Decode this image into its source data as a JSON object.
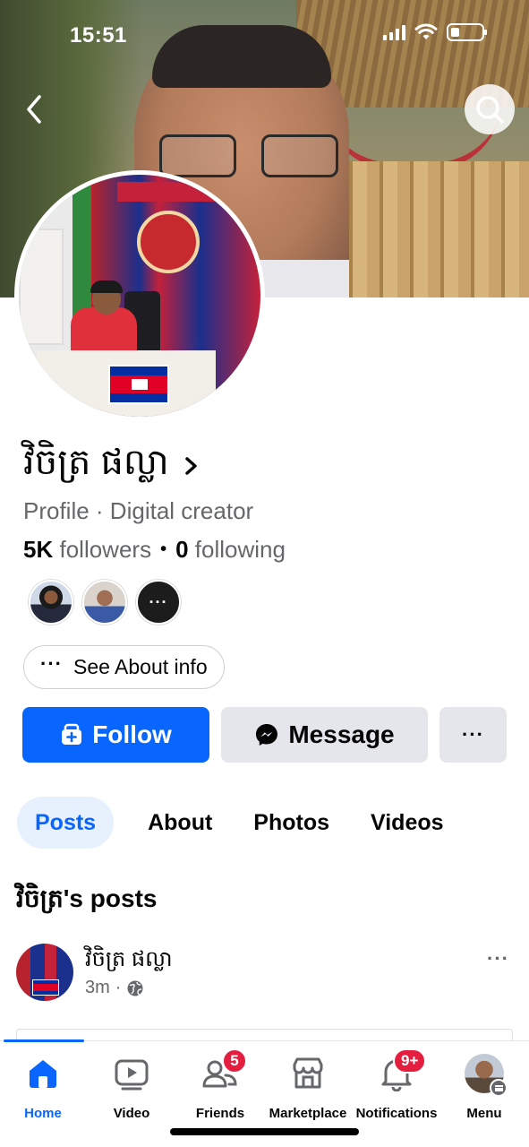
{
  "status_bar": {
    "time": "15:51"
  },
  "profile": {
    "name": "វិចិត្រ ផល្លា",
    "subtitle": "Profile · Digital creator",
    "followers_count": "5K",
    "followers_label": "followers",
    "following_count": "0",
    "following_label": "following",
    "mutual_more_label": "···"
  },
  "buttons": {
    "see_about": "See About info",
    "follow": "Follow",
    "message": "Message",
    "more": "···"
  },
  "tabs": [
    {
      "label": "Posts",
      "active": true
    },
    {
      "label": "About",
      "active": false
    },
    {
      "label": "Photos",
      "active": false
    },
    {
      "label": "Videos",
      "active": false
    }
  ],
  "posts_section": {
    "title": "វិចិត្រ's posts"
  },
  "post": {
    "author": "វិចិត្រ ផល្លា",
    "time": "3m",
    "separator": "·",
    "more": "···"
  },
  "bottom_nav": {
    "items": [
      {
        "label": "Home",
        "icon": "home-icon",
        "active": true
      },
      {
        "label": "Video",
        "icon": "video-icon",
        "active": false
      },
      {
        "label": "Friends",
        "icon": "friends-icon",
        "badge": "5"
      },
      {
        "label": "Marketplace",
        "icon": "marketplace-icon"
      },
      {
        "label": "Notifications",
        "icon": "bell-icon",
        "badge": "9+"
      },
      {
        "label": "Menu",
        "icon": "menu-avatar-icon"
      }
    ]
  },
  "colors": {
    "brand_blue": "#0866ff",
    "badge_red": "#e41e3f",
    "secondary_text": "#65676b",
    "button_gray": "#e4e6eb"
  }
}
